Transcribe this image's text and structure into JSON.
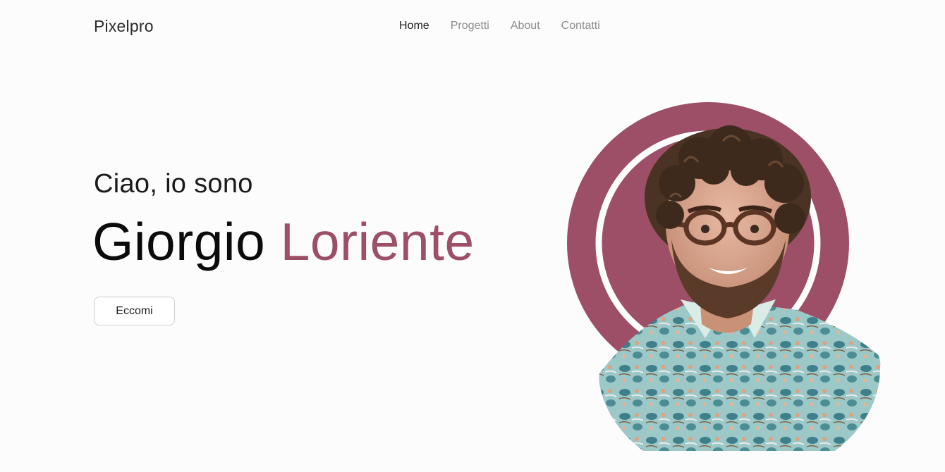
{
  "navbar": {
    "brand": "Pixelpro",
    "links": [
      {
        "label": "Home",
        "active": true
      },
      {
        "label": "Progetti",
        "active": false
      },
      {
        "label": "About",
        "active": false
      },
      {
        "label": "Contatti",
        "active": false
      }
    ]
  },
  "hero": {
    "greeting": "Ciao, io sono",
    "first_name": "Giorgio",
    "last_name": "Loriente",
    "button_label": "Eccomi"
  },
  "colors": {
    "accent": "#9c4f66",
    "background": "#fdfcfd",
    "text": "#0b0b0b",
    "nav_inactive": "#8c8c8c"
  },
  "icons": {
    "portrait": "person-portrait-image"
  }
}
